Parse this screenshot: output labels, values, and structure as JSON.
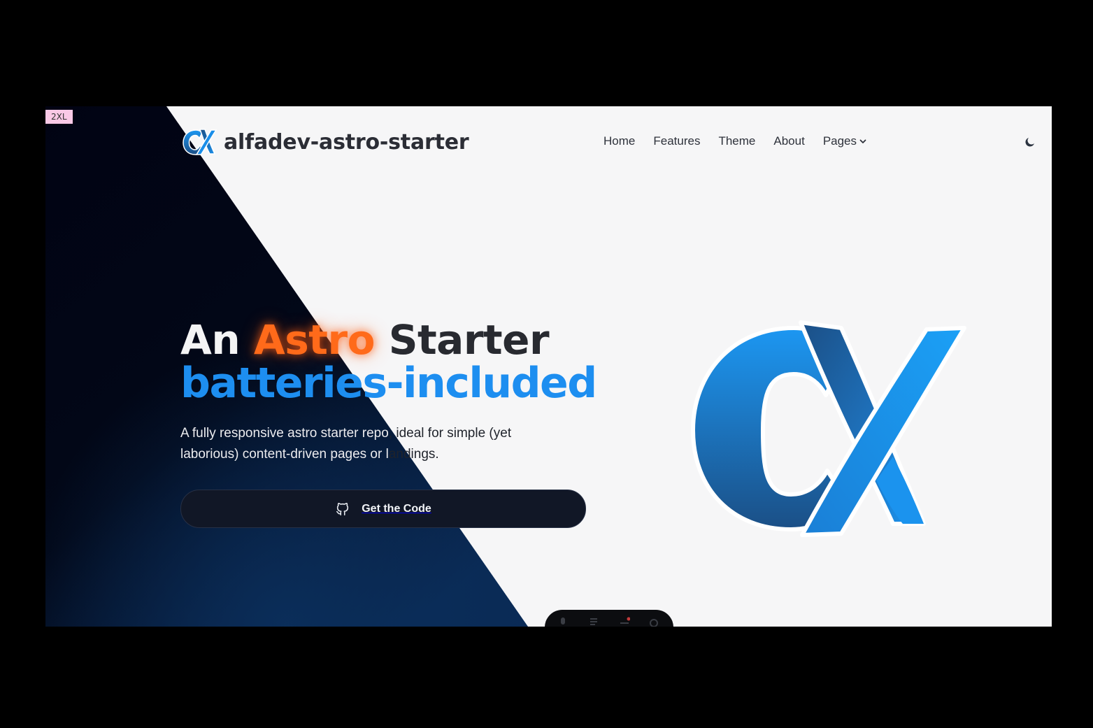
{
  "breakpoint_badge": "2XL",
  "brand": {
    "title": "alfadev-astro-starter",
    "logo_icon": "alpha-logo-icon"
  },
  "nav": {
    "items": [
      {
        "label": "Home"
      },
      {
        "label": "Features"
      },
      {
        "label": "Theme"
      },
      {
        "label": "About"
      },
      {
        "label": "Pages",
        "has_dropdown": true
      }
    ]
  },
  "theme_toggle": {
    "icon": "moon-icon"
  },
  "hero": {
    "headline": {
      "word_an": "An",
      "word_astro": "Astro",
      "word_starter": "Starter",
      "line2_part1": "batteries",
      "line2_part2": "-included"
    },
    "subtitle_parts": [
      "A fully responsive astro starter repo",
      ", ideal for simple (yet",
      "laborious) content-driven pages or l",
      "andings."
    ],
    "cta": {
      "label": "Get the Code",
      "icon": "github-icon"
    },
    "logo_icon": "alpha-logo-icon"
  },
  "colors": {
    "dark_wedge_top": "#02040f",
    "dark_wedge_bottom": "#08244a",
    "accent_orange": "#ff6a1a",
    "accent_blue": "#1d8ef0",
    "logo_blue_light": "#1c97f2",
    "logo_blue_dark": "#1b4f86",
    "page_bg": "#f6f6f7",
    "button_bg": "#111726"
  },
  "dev_toolbar": {
    "icons": [
      "microphone-icon",
      "inspect-icon",
      "audit-icon",
      "settings-icon"
    ]
  }
}
